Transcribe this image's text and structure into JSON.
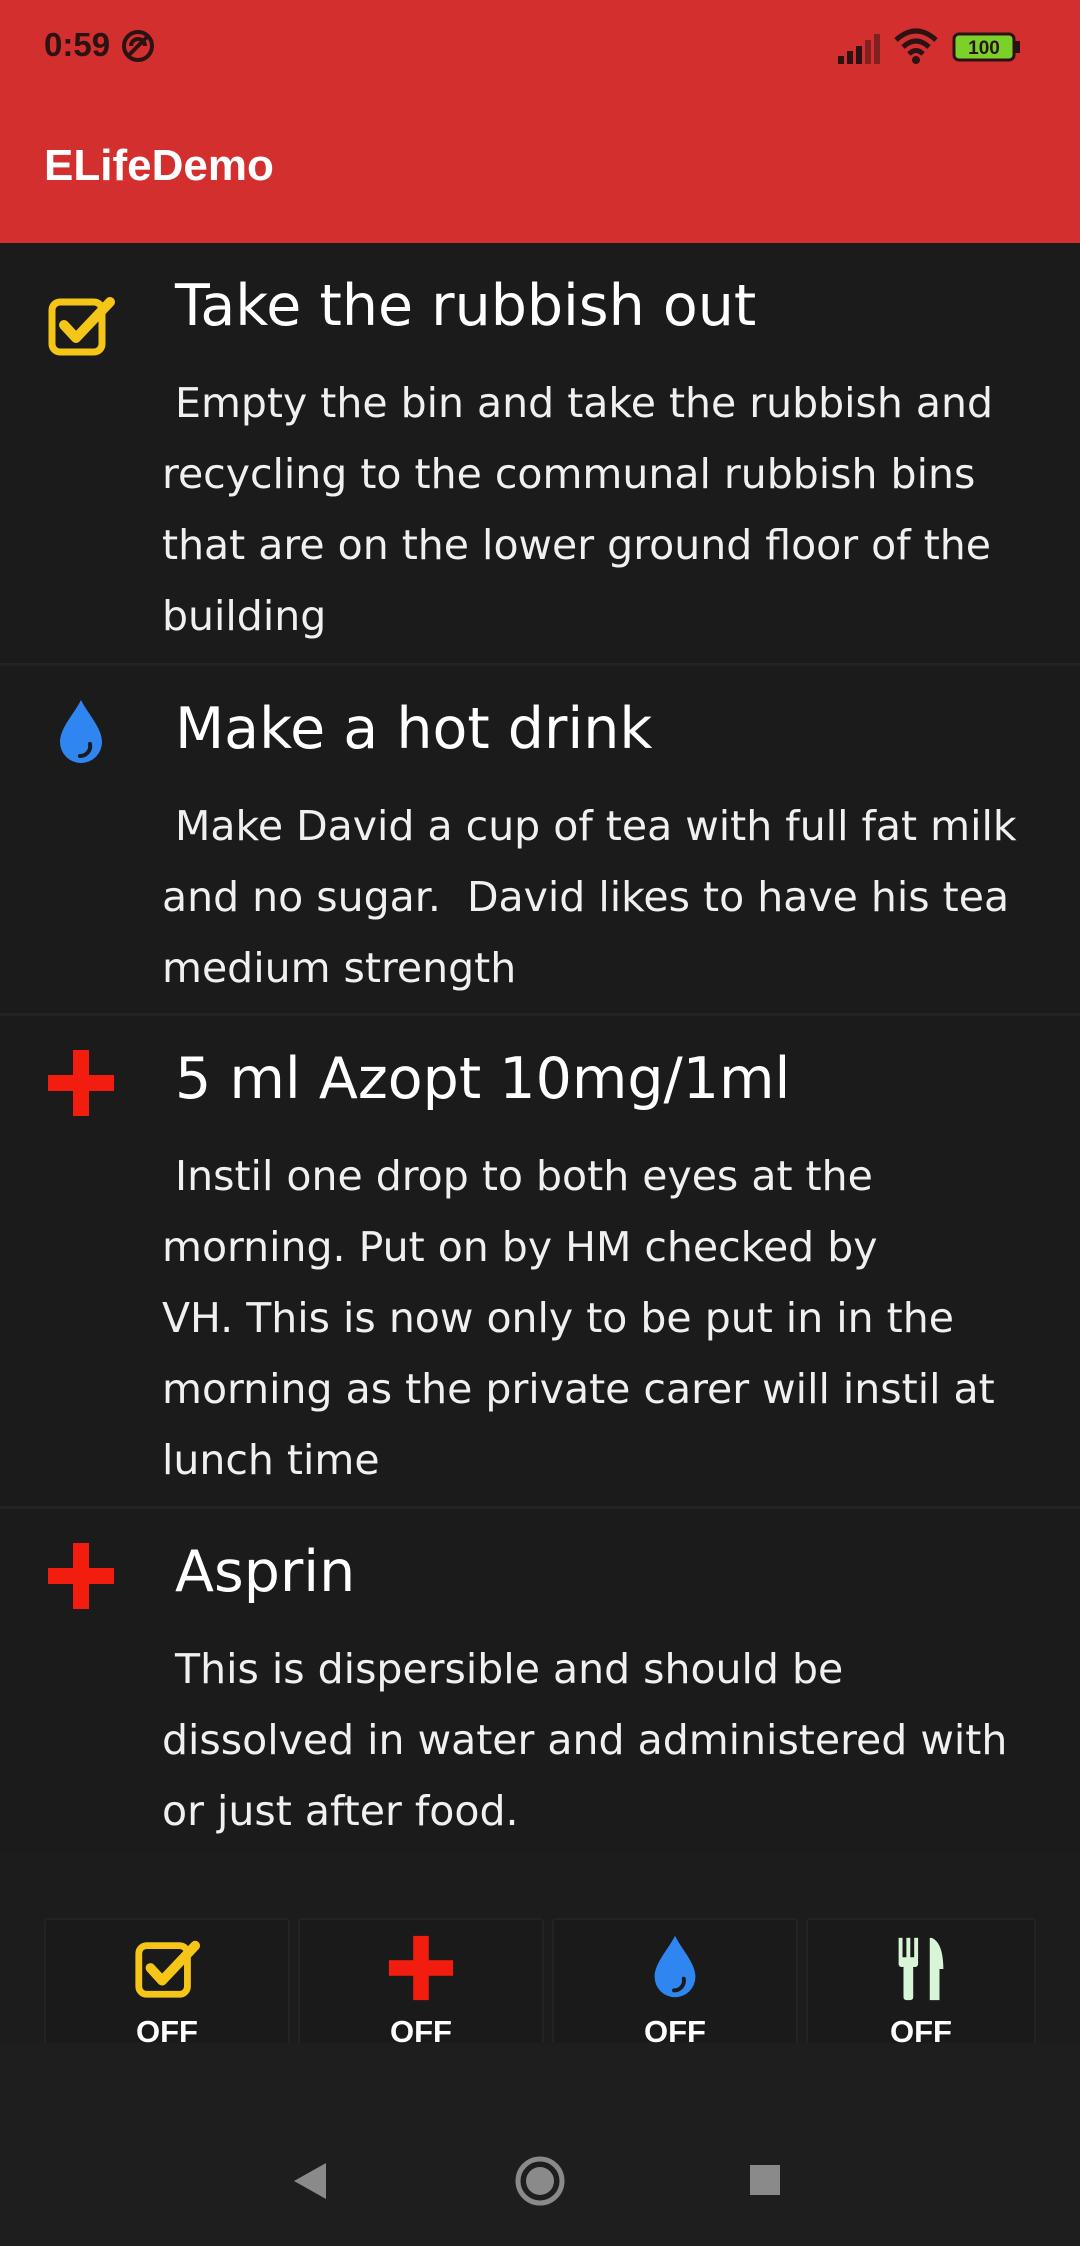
{
  "status_bar": {
    "time": "0:59",
    "battery": "100",
    "icons": [
      "do-not-disturb-icon",
      "signal-icon",
      "wifi-icon",
      "battery-icon"
    ]
  },
  "app_bar": {
    "title": "ELifeDemo"
  },
  "tasks": [
    {
      "icon": "checkbox-icon",
      "title": "Take the rubbish out",
      "description": " Empty the bin and take the rubbish and\nrecycling to the communal rubbish bins\nthat are on the lower ground floor of the\nbuilding"
    },
    {
      "icon": "water-drop-icon",
      "title": "Make a hot drink",
      "description": " Make David a cup of tea with full fat milk\nand no sugar.  David likes to have his tea\nmedium strength"
    },
    {
      "icon": "medical-cross-icon",
      "title": "5 ml Azopt 10mg/1ml",
      "description": " Instil one drop to both eyes at the\nmorning. Put on by HM checked by\nVH. This is now only to be put in in the\nmorning as the private carer will instil at\nlunch time"
    },
    {
      "icon": "medical-cross-icon",
      "title": "Asprin",
      "description": " This is dispersible and should be\ndissolved in water and administered with\nor just after food."
    }
  ],
  "filters": [
    {
      "icon": "checkbox-icon",
      "label": "OFF"
    },
    {
      "icon": "medical-cross-icon",
      "label": "OFF"
    },
    {
      "icon": "water-drop-icon",
      "label": "OFF"
    },
    {
      "icon": "cutlery-icon",
      "label": "OFF"
    }
  ],
  "colors": {
    "accent": "#d32f2f",
    "checkbox": "#f5c518",
    "cross": "#f21d0f",
    "drop": "#2f86f0",
    "cutlery": "#d8f5d8",
    "background": "#1e1e1e"
  }
}
